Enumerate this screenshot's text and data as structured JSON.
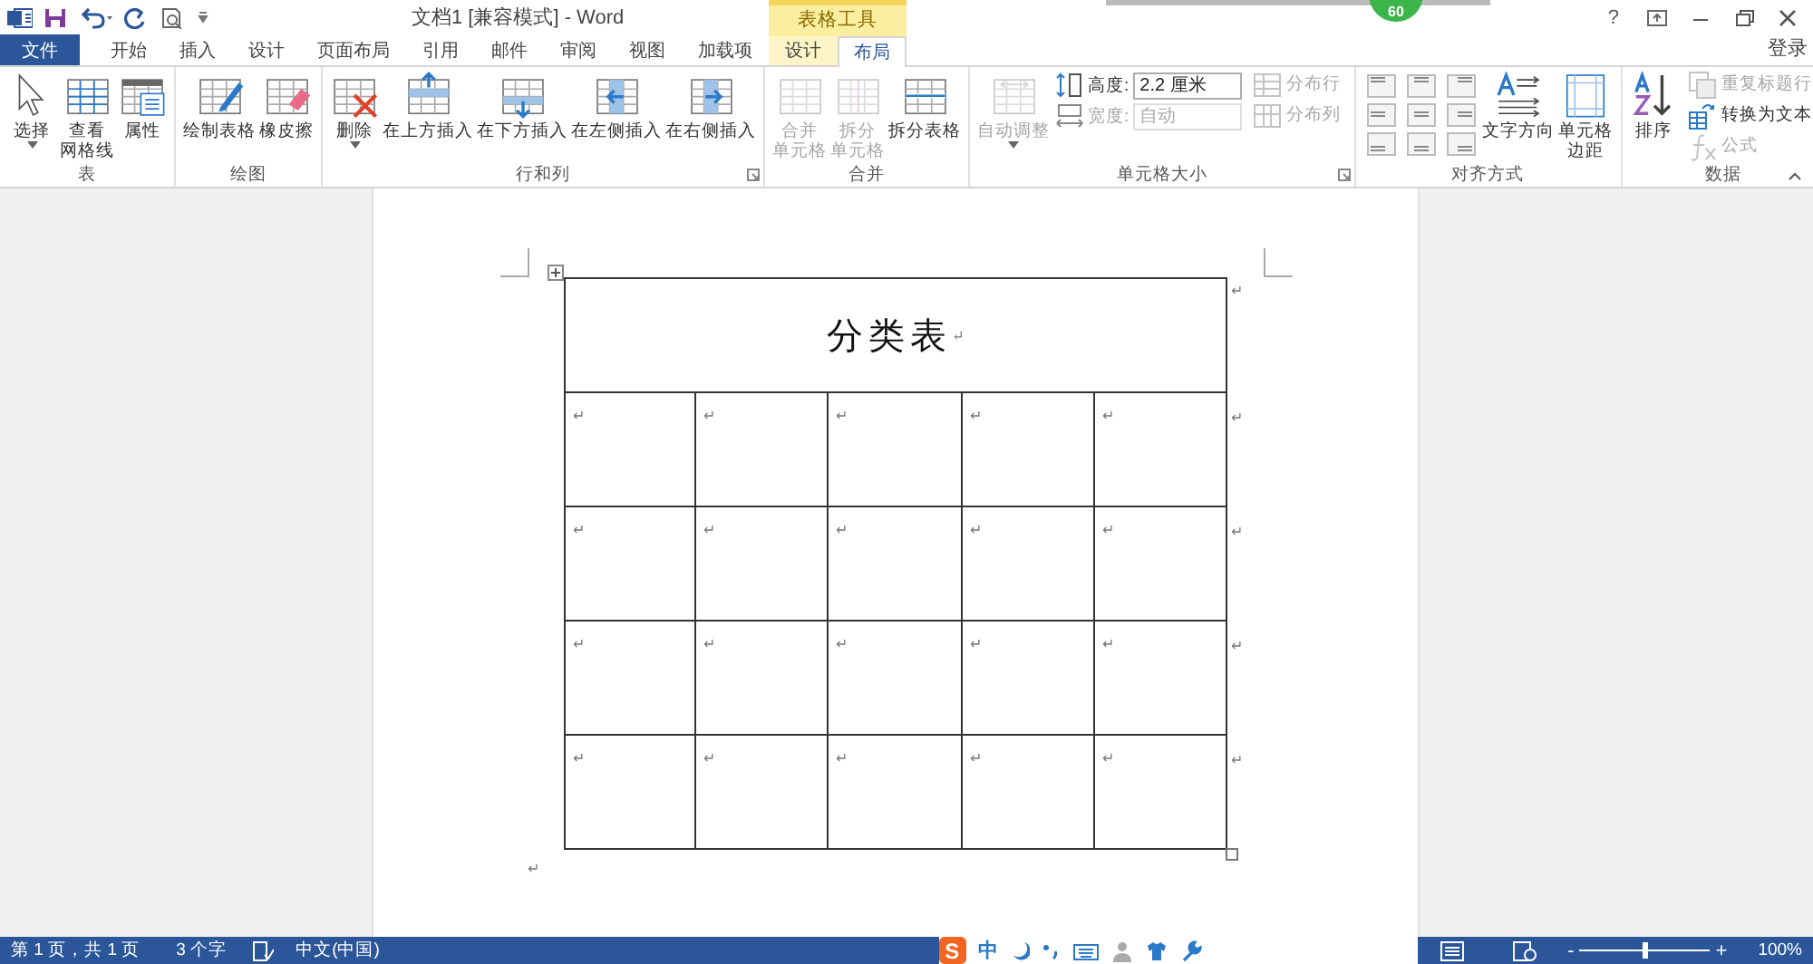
{
  "title_bar": {
    "title": "文档1 [兼容模式] - Word",
    "context_header": "表格工具",
    "help": "?",
    "sign_in": "登录",
    "overlay_badge": "60"
  },
  "tabs": [
    {
      "label": "文件",
      "kind": "file",
      "selected": false
    },
    {
      "label": "开始",
      "kind": "normal",
      "selected": false
    },
    {
      "label": "插入",
      "kind": "normal",
      "selected": false
    },
    {
      "label": "设计",
      "kind": "normal",
      "selected": false
    },
    {
      "label": "页面布局",
      "kind": "normal",
      "selected": false
    },
    {
      "label": "引用",
      "kind": "normal",
      "selected": false
    },
    {
      "label": "邮件",
      "kind": "normal",
      "selected": false
    },
    {
      "label": "审阅",
      "kind": "normal",
      "selected": false
    },
    {
      "label": "视图",
      "kind": "normal",
      "selected": false
    },
    {
      "label": "加载项",
      "kind": "normal",
      "selected": false
    },
    {
      "label": "设计",
      "kind": "context",
      "selected": false
    },
    {
      "label": "布局",
      "kind": "context",
      "selected": true
    }
  ],
  "ribbon": {
    "groups": [
      {
        "label": "表",
        "items": [
          {
            "kind": "large",
            "lines": [
              "选择"
            ],
            "dropdown": true,
            "disabled": false
          },
          {
            "kind": "large",
            "lines": [
              "查看",
              "网格线"
            ],
            "dropdown": false,
            "disabled": false
          },
          {
            "kind": "large",
            "lines": [
              "属性"
            ],
            "dropdown": false,
            "disabled": false
          }
        ]
      },
      {
        "label": "绘图",
        "items": [
          {
            "kind": "large",
            "lines": [
              "绘制表格"
            ],
            "dropdown": false,
            "disabled": false
          },
          {
            "kind": "large",
            "lines": [
              "橡皮擦"
            ],
            "dropdown": false,
            "disabled": false
          }
        ]
      },
      {
        "label": "行和列",
        "launcher": true,
        "items": [
          {
            "kind": "large",
            "lines": [
              "删除"
            ],
            "dropdown": true,
            "disabled": false
          },
          {
            "kind": "large",
            "lines": [
              "在上方插入"
            ],
            "dropdown": false,
            "disabled": false
          },
          {
            "kind": "large",
            "lines": [
              "在下方插入"
            ],
            "dropdown": false,
            "disabled": false
          },
          {
            "kind": "large",
            "lines": [
              "在左侧插入"
            ],
            "dropdown": false,
            "disabled": false
          },
          {
            "kind": "large",
            "lines": [
              "在右侧插入"
            ],
            "dropdown": false,
            "disabled": false
          }
        ]
      },
      {
        "label": "合并",
        "items": [
          {
            "kind": "large",
            "lines": [
              "合并",
              "单元格"
            ],
            "dropdown": false,
            "disabled": true
          },
          {
            "kind": "large",
            "lines": [
              "拆分",
              "单元格"
            ],
            "dropdown": false,
            "disabled": true
          },
          {
            "kind": "large",
            "lines": [
              "拆分表格"
            ],
            "dropdown": false,
            "disabled": false
          }
        ]
      },
      {
        "label": "单元格大小",
        "launcher": true,
        "items": [
          {
            "kind": "large",
            "lines": [
              "自动调整"
            ],
            "dropdown": true,
            "disabled": true
          },
          {
            "kind": "stack",
            "items": [
              {
                "kind": "field",
                "label": "高度:",
                "value": "2.2 厘米",
                "disabled": false
              },
              {
                "kind": "field",
                "label": "宽度:",
                "value": "自动",
                "disabled": true
              }
            ]
          },
          {
            "kind": "stack",
            "items": [
              {
                "kind": "small",
                "label": "分布行",
                "disabled": true
              },
              {
                "kind": "small",
                "label": "分布列",
                "disabled": true
              }
            ]
          }
        ]
      },
      {
        "label": "对齐方式",
        "items": [
          {
            "kind": "align-grid"
          },
          {
            "kind": "large",
            "lines": [
              "文字方向"
            ],
            "dropdown": false,
            "disabled": false
          },
          {
            "kind": "large",
            "lines": [
              "单元格",
              "边距"
            ],
            "dropdown": false,
            "disabled": false
          }
        ]
      },
      {
        "label": "数据",
        "items": [
          {
            "kind": "large",
            "lines": [
              "排序"
            ],
            "dropdown": false,
            "disabled": false
          },
          {
            "kind": "stack",
            "items": [
              {
                "kind": "small",
                "label": "重复标题行",
                "disabled": true
              },
              {
                "kind": "small",
                "label": "转换为文本",
                "disabled": false
              },
              {
                "kind": "small",
                "label": "公式",
                "disabled": true
              }
            ]
          }
        ]
      }
    ]
  },
  "document": {
    "table": {
      "title": "分类表",
      "title_mark": "↵",
      "title_end_mark": "↵",
      "rows": [
        {
          "cells": [
            "↵",
            "↵",
            "↵",
            "↵",
            "↵"
          ],
          "end_mark": "↵"
        },
        {
          "cells": [
            "↵",
            "↵",
            "↵",
            "↵",
            "↵"
          ],
          "end_mark": "↵"
        },
        {
          "cells": [
            "↵",
            "↵",
            "↵",
            "↵",
            "↵"
          ],
          "end_mark": "↵"
        },
        {
          "cells": [
            "↵",
            "↵",
            "↵",
            "↵",
            "↵"
          ],
          "end_mark": "↵"
        }
      ]
    },
    "after_mark": "↵"
  },
  "status_bar": {
    "page": "第 1 页，共 1 页",
    "words": "3 个字",
    "language": "中文(中国)",
    "ime": {
      "logo": "S",
      "mode": "中"
    },
    "zoom_minus": "-",
    "zoom_plus": "+",
    "zoom": {
      "level": 0.5
    },
    "zoom_label": "100%"
  }
}
